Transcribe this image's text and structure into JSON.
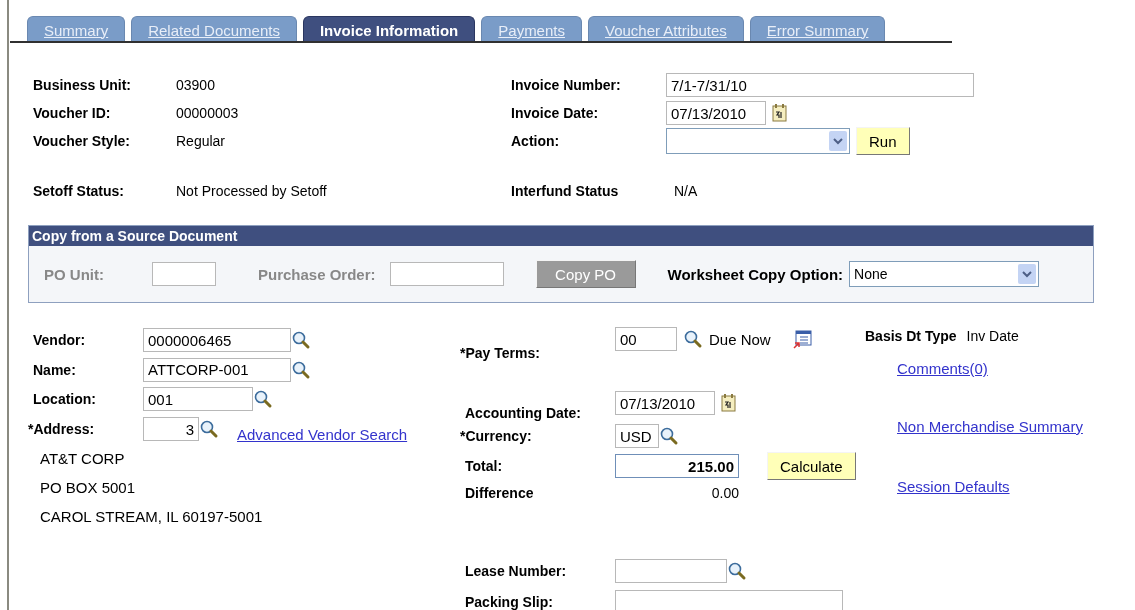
{
  "tabs": [
    {
      "label": "Summary",
      "selected": false
    },
    {
      "label": "Related Documents",
      "selected": false
    },
    {
      "label": "Invoice Information",
      "selected": true
    },
    {
      "label": "Payments",
      "selected": false
    },
    {
      "label": "Voucher Attributes",
      "selected": false
    },
    {
      "label": "Error Summary",
      "selected": false
    }
  ],
  "header_left": [
    {
      "label": "Business Unit:",
      "value": "03900"
    },
    {
      "label": "Voucher ID:",
      "value": "00000003"
    },
    {
      "label": "Voucher Style:",
      "value": "Regular"
    }
  ],
  "header_right": [
    {
      "kind": "input",
      "label": "Invoice Number:",
      "value": "7/1-7/31/10"
    },
    {
      "kind": "date",
      "label": "Invoice Date:",
      "value": "07/13/2010"
    },
    {
      "kind": "select",
      "label": "Action:",
      "button": "Run"
    }
  ],
  "setoff_status": {
    "label": "Setoff Status:",
    "value": "Not Processed by Setoff"
  },
  "interfund_status": {
    "label": "Interfund Status",
    "value": "N/A"
  },
  "copy_section": {
    "title": "Copy from a Source Document",
    "po_unit": {
      "label": "PO Unit:",
      "disabled": true
    },
    "purchase_order": {
      "label": "Purchase Order:",
      "disabled": true
    },
    "copy_button": {
      "label": "Copy PO",
      "disabled": true
    },
    "worksheet": {
      "label": "Worksheet Copy Option:",
      "value": "None"
    }
  },
  "vendor_fields": [
    {
      "label": "Vendor:",
      "value": "0000006465"
    },
    {
      "label": "Name:",
      "value": "ATTCORP-001"
    },
    {
      "label": "Location:",
      "value": "001"
    },
    {
      "label": "*Address:",
      "value": "3"
    }
  ],
  "advanced_search_link": "Advanced Vendor Search",
  "address_lines": [
    "AT&T CORP",
    "PO BOX 5001",
    "CAROL STREAM, IL  60197-5001"
  ],
  "pay_terms": {
    "label": "*Pay Terms:",
    "value": "00",
    "description": "Due Now"
  },
  "accounting_date": {
    "label": "Accounting Date:",
    "value": "07/13/2010"
  },
  "currency": {
    "label": "*Currency:",
    "value": "USD"
  },
  "total": {
    "label": "Total:",
    "value": "215.00",
    "button": "Calculate"
  },
  "difference": {
    "label": "Difference",
    "value": "0.00"
  },
  "lease_number": {
    "label": "Lease Number:"
  },
  "packing_slip": {
    "label": "Packing Slip:"
  },
  "basis_dt_type": {
    "label": "Basis Dt Type",
    "value": "Inv Date"
  },
  "links": [
    "Comments(0)",
    "Non Merchandise Summary",
    "Session Defaults"
  ]
}
